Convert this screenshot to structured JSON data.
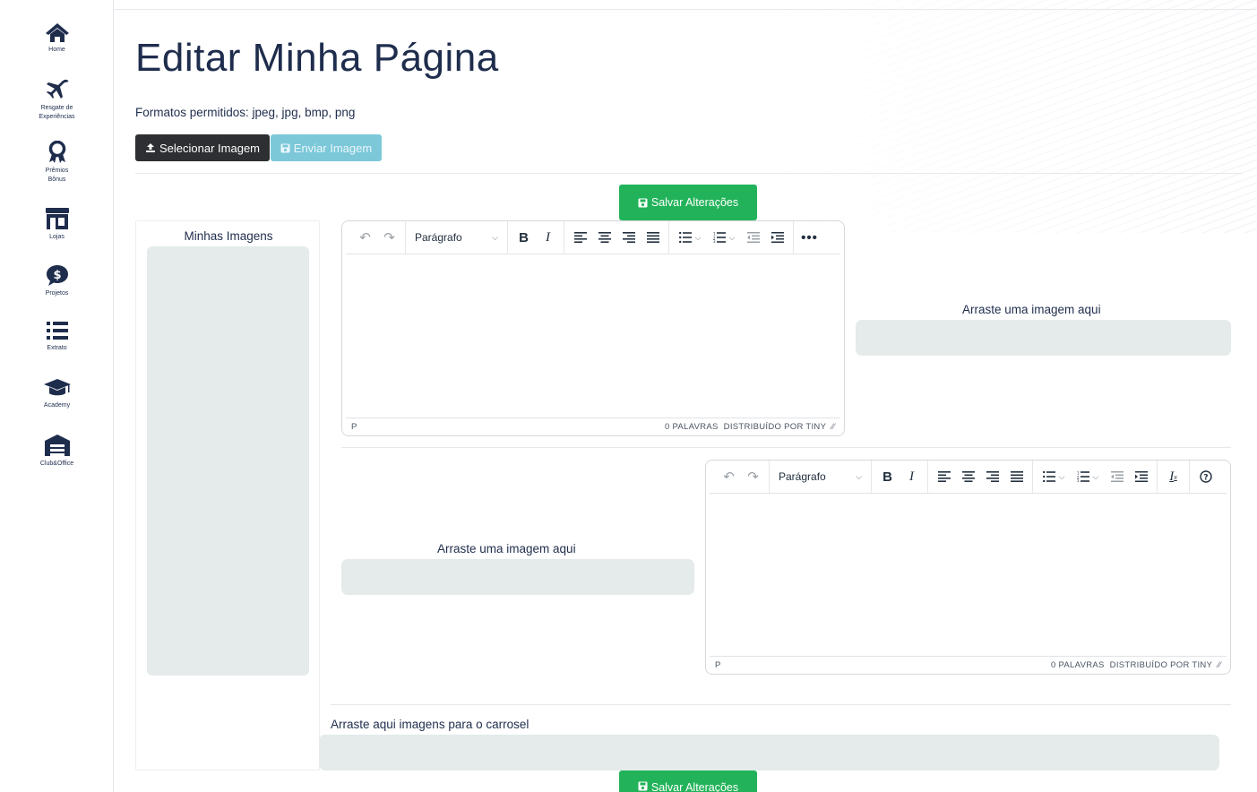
{
  "sidebar": {
    "items": [
      {
        "label": "Home",
        "icon": "home-icon"
      },
      {
        "label": "Resgate de Experiências",
        "icon": "airplane-icon"
      },
      {
        "label": "Prêmios Bônus",
        "icon": "award-icon"
      },
      {
        "label": "Lojas",
        "icon": "store-icon"
      },
      {
        "label": "Projetos",
        "icon": "money-comment-icon"
      },
      {
        "label": "Extrato",
        "icon": "list-icon"
      },
      {
        "label": "Academy",
        "icon": "graduation-cap-icon"
      },
      {
        "label": "Club&Office",
        "icon": "warehouse-icon"
      }
    ]
  },
  "main": {
    "title": "Editar Minha Página",
    "formats": "Formatos permitidos: jpeg, jpg, bmp, png",
    "select_button": "Selecionar Imagem",
    "send_button": "Enviar Imagem",
    "save_button": "Salvar Alterações",
    "images_panel_title": "Minhas Imagens",
    "drop_label": "Arraste uma imagem aqui",
    "carousel_label": "Arraste aqui imagens para o carrosel"
  },
  "editor": {
    "block_format": "Parágrafo",
    "status_path": "P",
    "word_count": "0 PALAVRAS",
    "powered_by": "DISTRIBUÍDO POR TINY"
  },
  "colors": {
    "primary_text": "#1f2d4d",
    "save_green": "#22b35a",
    "select_dark": "#2d2f32",
    "send_light_blue": "#7cc8d9",
    "dropzone_bg": "#e4ebea"
  }
}
